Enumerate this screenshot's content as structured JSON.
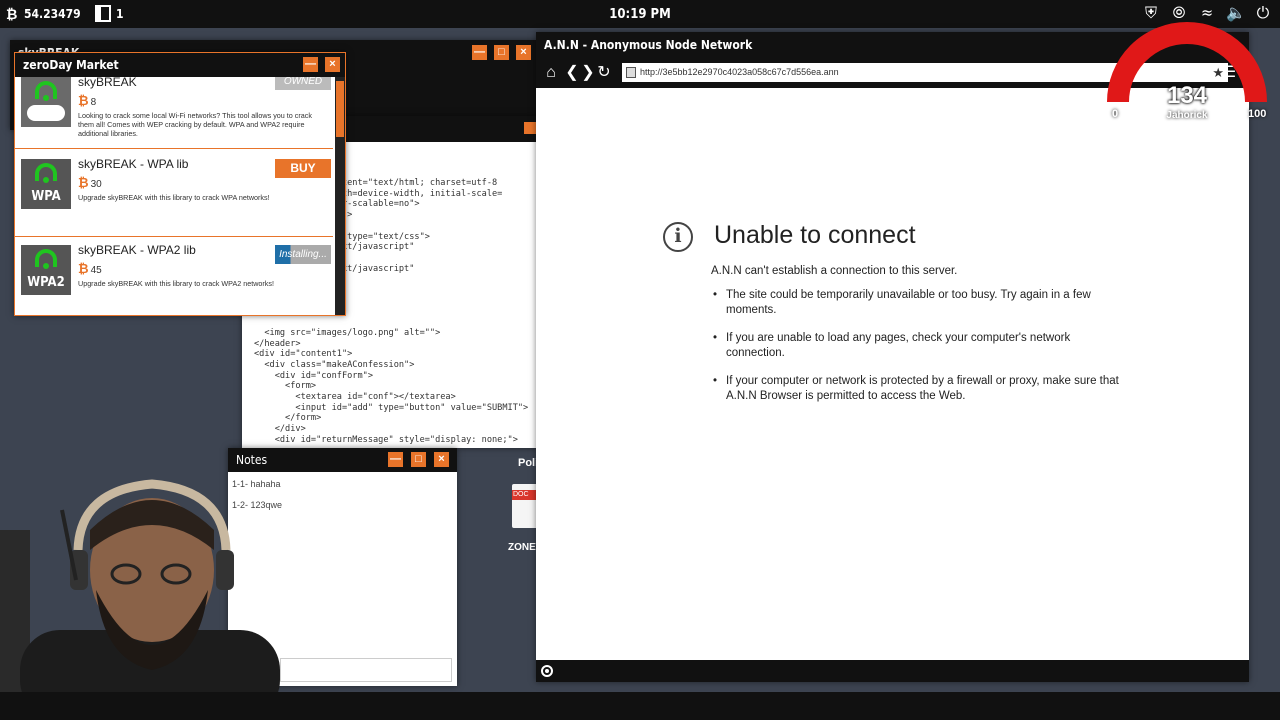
{
  "taskbar": {
    "balance": "54.23479",
    "notif_count": "1",
    "clock": "10:19 PM"
  },
  "skybreak_window": {
    "title": "skyBREAK"
  },
  "code_window": {
    "lines": [
      "content-Type\" content=\"text/html; charset=utf-8",
      "ort\" content=\"width=device-width, initial-scale=",
      "imum-scale=1, user-scalable=no\">",
      "iption\" content=\"\">",
      "e>",
      " href=\"style.css\" type=\"text/css\">",
      "ascript\" type=\"text/javascript\"",
      "script>",
      "ascript\" type=\"text/javascript\"",
      "",
      "",
      "",
      "",
      "",
      "  <img src=\"images/logo.png\" alt=\"\">",
      "</header>",
      "<div id=\"content1\">",
      "  <div class=\"makeAConfession\">",
      "    <div id=\"confForm\">",
      "      <form>",
      "        <textarea id=\"conf\"></textarea>",
      "        <input id=\"add\" type=\"button\" value=\"SUBMIT\">",
      "      </form>",
      "    </div>",
      "    <div id=\"returnMessage\" style=\"display: none;\">"
    ]
  },
  "market": {
    "title": "zeroDay Market",
    "items": [
      {
        "name": "skyBREAK",
        "price": "8",
        "icon_label": "",
        "desc": "Looking to crack some local Wi-Fi networks? This tool allows you to crack them all! Comes with WEP cracking by default. WPA and WPA2 require additional libraries.",
        "action": "OWNED"
      },
      {
        "name": "skyBREAK - WPA lib",
        "price": "30",
        "icon_label": "WPA",
        "desc": "Upgrade skyBREAK with this library to crack WPA networks!",
        "action": "BUY"
      },
      {
        "name": "skyBREAK - WPA2 lib",
        "price": "45",
        "icon_label": "WPA2",
        "desc": "Upgrade skyBREAK with this library to crack WPA2 networks!",
        "action": "Installing..."
      }
    ]
  },
  "notes": {
    "title": "Notes",
    "entries": [
      "1-1- hahaha",
      "1-2- 123qwe"
    ]
  },
  "desktop": {
    "poli_label": "Poli",
    "doc_tag": "DOC",
    "zone_label": "ZONEW"
  },
  "browser": {
    "title": "A.N.N - Anonymous Node Network",
    "url": "http://3e5bb12e2970c4023a058c67c7d556ea.ann",
    "error_title": "Unable to connect",
    "error_sub": "A.N.N can't establish a connection to this server.",
    "bullets": [
      "The site could be temporarily unavailable or too busy. Try again in a few moments.",
      "If you are unable to load any pages, check your computer's network connection.",
      "If your computer or network is protected by a firewall or proxy, make sure that A.N.N Browser is permitted to access the Web."
    ]
  },
  "gauge": {
    "value": "134",
    "user": "Jahorick",
    "min": "0",
    "max": "100",
    "color": "#e01818"
  },
  "colors": {
    "accent": "#e8742a",
    "installing": "#1f6fa8",
    "wifi": "#1fc51f"
  }
}
